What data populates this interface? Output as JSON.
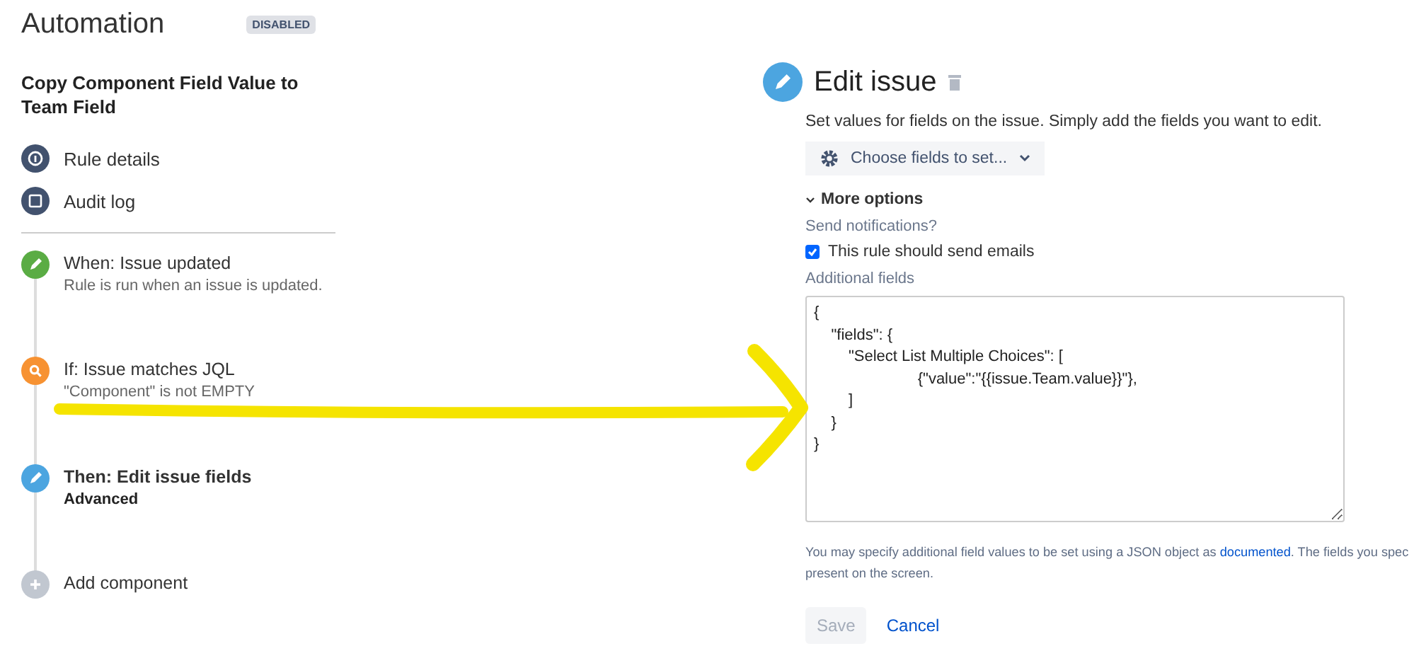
{
  "header": {
    "title": "Automation",
    "status_badge": "DISABLED"
  },
  "rule_name": "Copy Component Field Value to Team Field",
  "nav_items": [
    {
      "label": "Rule details",
      "kind": "info"
    },
    {
      "label": "Audit log",
      "kind": "log"
    }
  ],
  "steps": [
    {
      "kind": "trigger",
      "title": "When: Issue updated",
      "subtitle": "Rule is run when an issue is updated.",
      "selected": false
    },
    {
      "kind": "condition",
      "title": "If: Issue matches JQL",
      "subtitle": "\"Component\" is not EMPTY",
      "selected": false
    },
    {
      "kind": "action",
      "title": "Then: Edit issue fields",
      "subtitle": "Advanced",
      "selected": true
    },
    {
      "kind": "add",
      "title": "Add component",
      "selected": false
    }
  ],
  "editor": {
    "title": "Edit issue",
    "description": "Set values for fields on the issue. Simply add the fields you want to edit.",
    "choose_fields": "Choose fields to set...",
    "more_options": {
      "label": "More options",
      "expanded": true
    },
    "notifications_label": "Send notifications?",
    "send_emails": {
      "label": "This rule should send emails",
      "checked": true
    },
    "additional_fields_label": "Additional fields",
    "additional_fields_value": "{\n    \"fields\": {\n        \"Select List Multiple Choices\": [\n                        {\"value\":\"{{issue.Team.value}}\"},\n        ]\n    }\n}",
    "help": {
      "before": "You may specify additional field values to be set using a JSON object as ",
      "link": "documented",
      "after": ". The fields you spec",
      "line2": "present on the screen."
    },
    "buttons": [
      {
        "label": "Save",
        "disabled": true
      },
      {
        "label": "Cancel",
        "disabled": false
      }
    ]
  }
}
